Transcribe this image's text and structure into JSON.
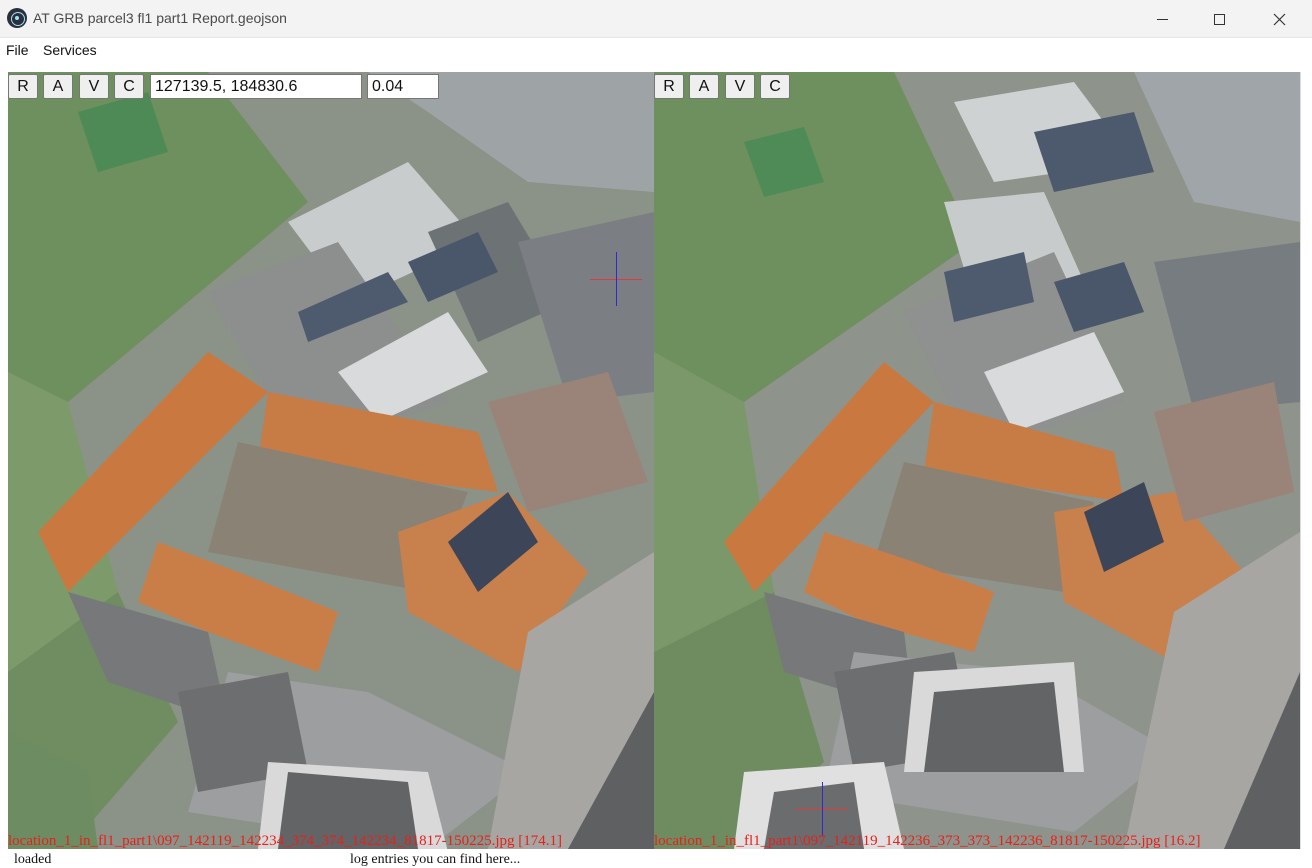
{
  "window": {
    "title": "AT GRB parcel3 fl1 part1 Report.geojson",
    "controls": {
      "minimize": "minimize-icon",
      "maximize": "maximize-icon",
      "close": "close-icon"
    }
  },
  "menu": {
    "file": "File",
    "services": "Services"
  },
  "left_viewer": {
    "buttons": [
      "R",
      "A",
      "V",
      "C"
    ],
    "coordinates_value": "127139.5, 184830.6",
    "scale_value": "0.04",
    "caption": "location_1_in_fl1_part1\\097_142119_142234_374_374_142234_81817-150225.jpg [174.1]"
  },
  "right_viewer": {
    "buttons": [
      "R",
      "A",
      "V",
      "C"
    ],
    "caption": "location_1_in_fl1_part1\\097_142119_142236_373_373_142236_81817-150225.jpg [16.2]"
  },
  "status": {
    "left": "loaded",
    "middle": "log entries you can find here..."
  },
  "colors": {
    "caption_text": "#e8201a",
    "crosshair_horizontal": "#e23a3a",
    "crosshair_vertical": "#2c2cd6"
  }
}
